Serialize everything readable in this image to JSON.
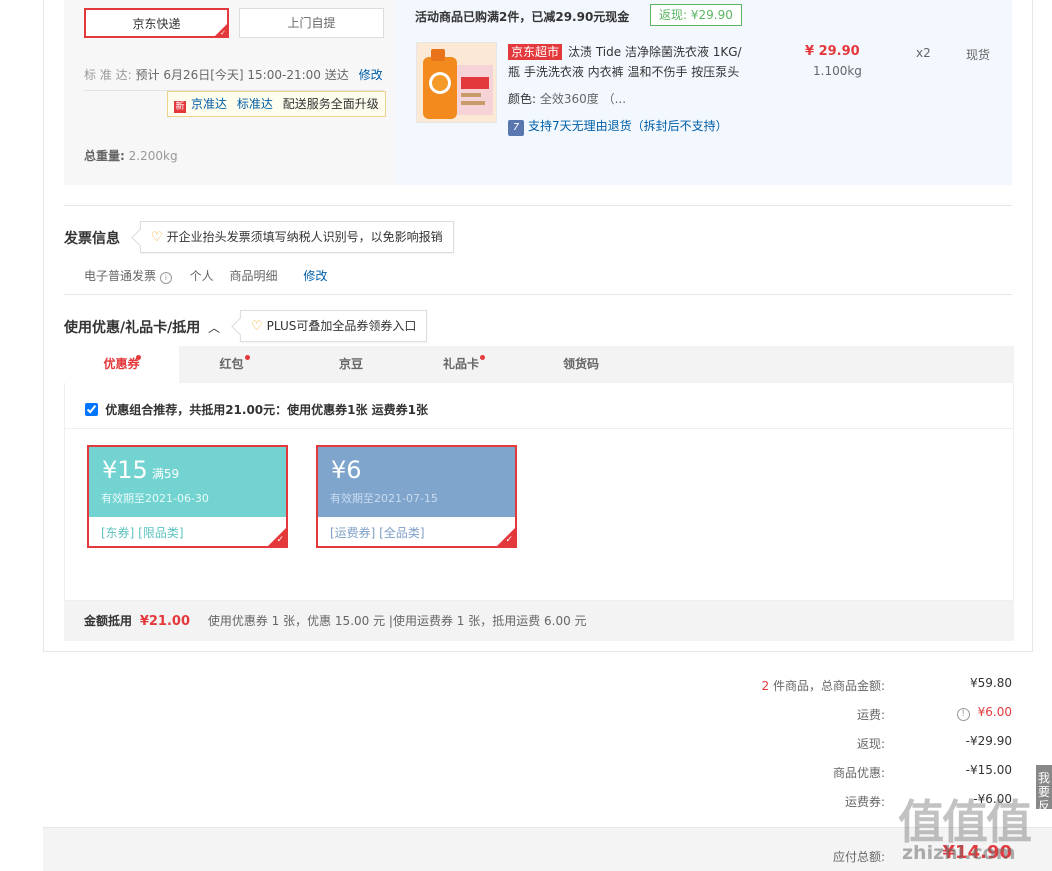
{
  "shipping": {
    "option_selected": "京东快递",
    "option_other": "上门自提",
    "standard_label": "标 准 达:",
    "standard_time": "预计 6月26日[今天] 15:00-21:00 送达",
    "modify": "修改",
    "upgrade_tip": {
      "badge": "新",
      "brand": "京准达",
      "link": "标准达",
      "text": "配送服务全面升级"
    },
    "weight_label": "总重量:",
    "weight_value": "2.200kg"
  },
  "goods": {
    "promo_text": "活动商品已购满2件，已减29.90元现金",
    "cashback_tag": "返现: ¥29.90",
    "product": {
      "store_tag": "京东超市",
      "title": "汰渍 Tide 洁净除菌洗衣液 1KG/瓶 手洗洗衣液 内衣裤 温和不伤手 按压泵头",
      "title_line1": "汰渍 Tide 洁净除菌洗衣液 1KG/",
      "title_line2": "瓶 手洗洗衣液 内衣裤 温和不伤手 按压泵头",
      "price": "¥ 29.90",
      "weight": "1.100kg",
      "qty": "x2",
      "stock": "现货",
      "color_label": "颜色:",
      "color_value": "全效360度 （...",
      "return_icon": "7",
      "return_policy": "支持7天无理由退货（拆封后不支持）"
    }
  },
  "invoice": {
    "title": "发票信息",
    "tip": "开企业抬头发票须填写纳税人识别号，以免影响报销",
    "type": "电子普通发票",
    "info_icon": "i",
    "head": "个人",
    "content": "商品明细",
    "modify": "修改"
  },
  "discount": {
    "title": "使用优惠/礼品卡/抵用",
    "tip": "PLUS可叠加全品券领券入口",
    "tabs": [
      {
        "label": "优惠券",
        "dot": true
      },
      {
        "label": "红包",
        "dot": true
      },
      {
        "label": "京豆",
        "dot": false
      },
      {
        "label": "礼品卡",
        "dot": true
      },
      {
        "label": "领货码",
        "dot": false
      }
    ],
    "combo_text": "优惠组合推荐，共抵用21.00元：使用优惠券1张 运费券1张",
    "coupons": [
      {
        "amount": "¥15",
        "condition": "满59",
        "valid": "有效期至2021-06-30",
        "tags": "[东券]  [限品类]",
        "color": "#72d3d1"
      },
      {
        "amount": "¥6",
        "condition": "",
        "valid": "有效期至2021-07-15",
        "tags": "[运费券]  [全品类]",
        "color": "#7fa5cc"
      }
    ],
    "summary_label": "金额抵用",
    "summary_amount": "¥21.00",
    "summary_detail": "使用优惠券 1 张，优惠 15.00 元  |使用运费券 1 张，抵用运费 6.00 元"
  },
  "totals": {
    "count": "2",
    "count_label": "件商品，总商品金额:",
    "goods_amount": "¥59.80",
    "freight_label": "运费:",
    "freight_value": "¥6.00",
    "cashback_label": "返现:",
    "cashback_value": "-¥29.90",
    "discount_label": "商品优惠:",
    "discount_value": "-¥15.00",
    "freight_coupon_label": "运费券:",
    "freight_coupon_value": "-¥6.00",
    "payable_label": "应付总额:",
    "payable_value": "¥14.90"
  },
  "feedback": "我要反馈",
  "watermark": {
    "main": "值值值",
    "sub": "zhizhi.com"
  },
  "colors": {
    "accent": "#e4393c",
    "link": "#005ea7",
    "coupon_teal": "#72d3d1",
    "coupon_blue": "#7fa5cc",
    "goods_bg": "#f3f8fe"
  }
}
